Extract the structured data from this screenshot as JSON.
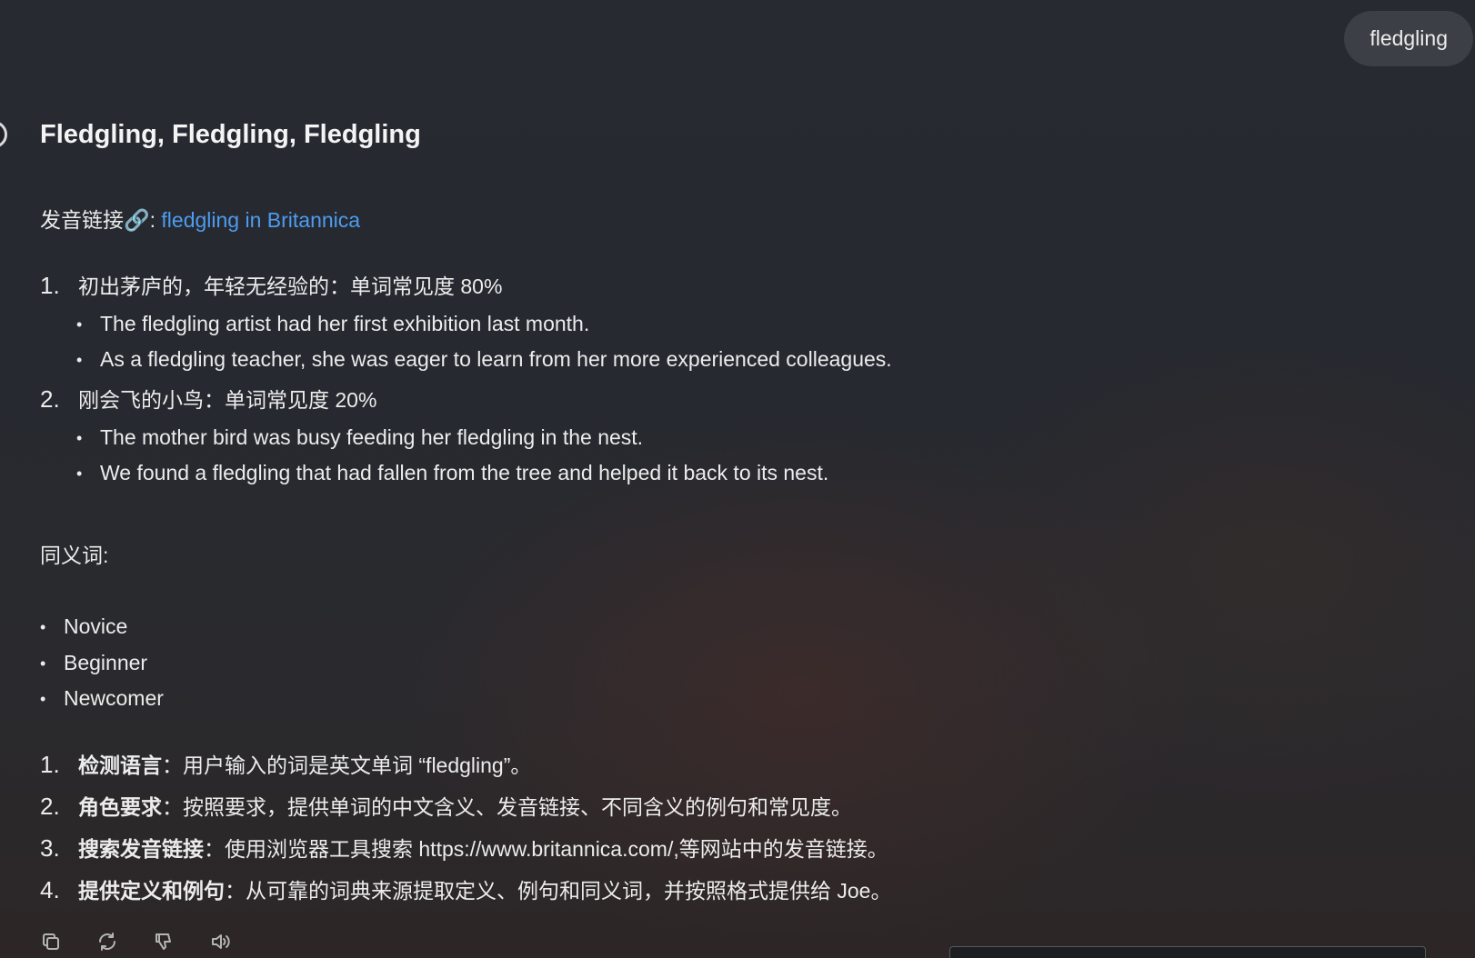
{
  "user_message": "fledgling",
  "response": {
    "title": "Fledgling, Fledgling, Fledgling",
    "pronunciation": {
      "label": "发音链接🔗: ",
      "link_text": "fledgling in Britannica"
    },
    "meanings": [
      {
        "number": "1.",
        "text": "初出茅庐的，年轻无经验的：单词常见度 80%",
        "examples": [
          "The fledgling artist had her first exhibition last month.",
          "As a fledgling teacher, she was eager to learn from her more experienced colleagues."
        ]
      },
      {
        "number": "2.",
        "text": "刚会飞的小鸟：单词常见度 20%",
        "examples": [
          "The mother bird was busy feeding her fledgling in the nest.",
          "We found a fledgling that had fallen from the tree and helped it back to its nest."
        ]
      }
    ],
    "synonyms_label": "同义词:",
    "synonyms": [
      "Novice",
      "Beginner",
      "Newcomer"
    ],
    "steps": [
      {
        "number": "1.",
        "bold": "检测语言",
        "text": "：用户输入的词是英文单词 “fledgling”。"
      },
      {
        "number": "2.",
        "bold": "角色要求",
        "text": "：按照要求，提供单词的中文含义、发音链接、不同含义的例句和常见度。"
      },
      {
        "number": "3.",
        "bold": "搜索发音链接",
        "text": "：使用浏览器工具搜索 https://www.britannica.com/,等网站中的发音链接。"
      },
      {
        "number": "4.",
        "bold": "提供定义和例句",
        "text": "：从可靠的词典来源提取定义、例句和同义词，并按照格式提供给 Joe。"
      }
    ]
  },
  "actions": {
    "icons": [
      "copy-icon",
      "regenerate-icon",
      "thumbs-down-icon",
      "read-aloud-icon"
    ]
  },
  "colors": {
    "background": "#272a30",
    "text": "#ececec",
    "link": "#4d9cf0",
    "bubble": "#3c3f45"
  }
}
